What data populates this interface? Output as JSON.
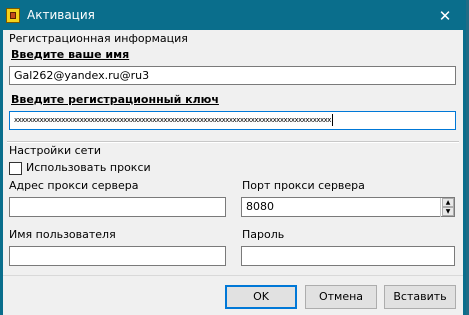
{
  "window": {
    "title": "Активация",
    "close_glyph": "✕",
    "titlebar_color": "#0a6e8c"
  },
  "registration": {
    "group_label": "Регистрационная информация",
    "name_label": "Введите ваше имя",
    "name_value": "Gal262@yandex.ru@ru3",
    "key_label": "Введите регистрационный ключ",
    "key_value": "xxxxxxxxxxxxxxxxxxxxxxxxxxxxxxxxxxxxxxxxxxxxxxxxxxxxxxxxxxxxxxxxxxxxxxxxxxxxxxxxxxxxxxx"
  },
  "network": {
    "group_label": "Настройки сети",
    "use_proxy_label": "Использовать прокси",
    "proxy_address_label": "Адрес прокси сервера",
    "proxy_address_value": "",
    "proxy_port_label": "Порт прокси сервера",
    "proxy_port_value": "8080",
    "username_label": "Имя пользователя",
    "username_value": "",
    "password_label": "Пароль",
    "password_value": ""
  },
  "buttons": {
    "ok": "OK",
    "cancel": "Отмена",
    "paste": "Вставить"
  }
}
